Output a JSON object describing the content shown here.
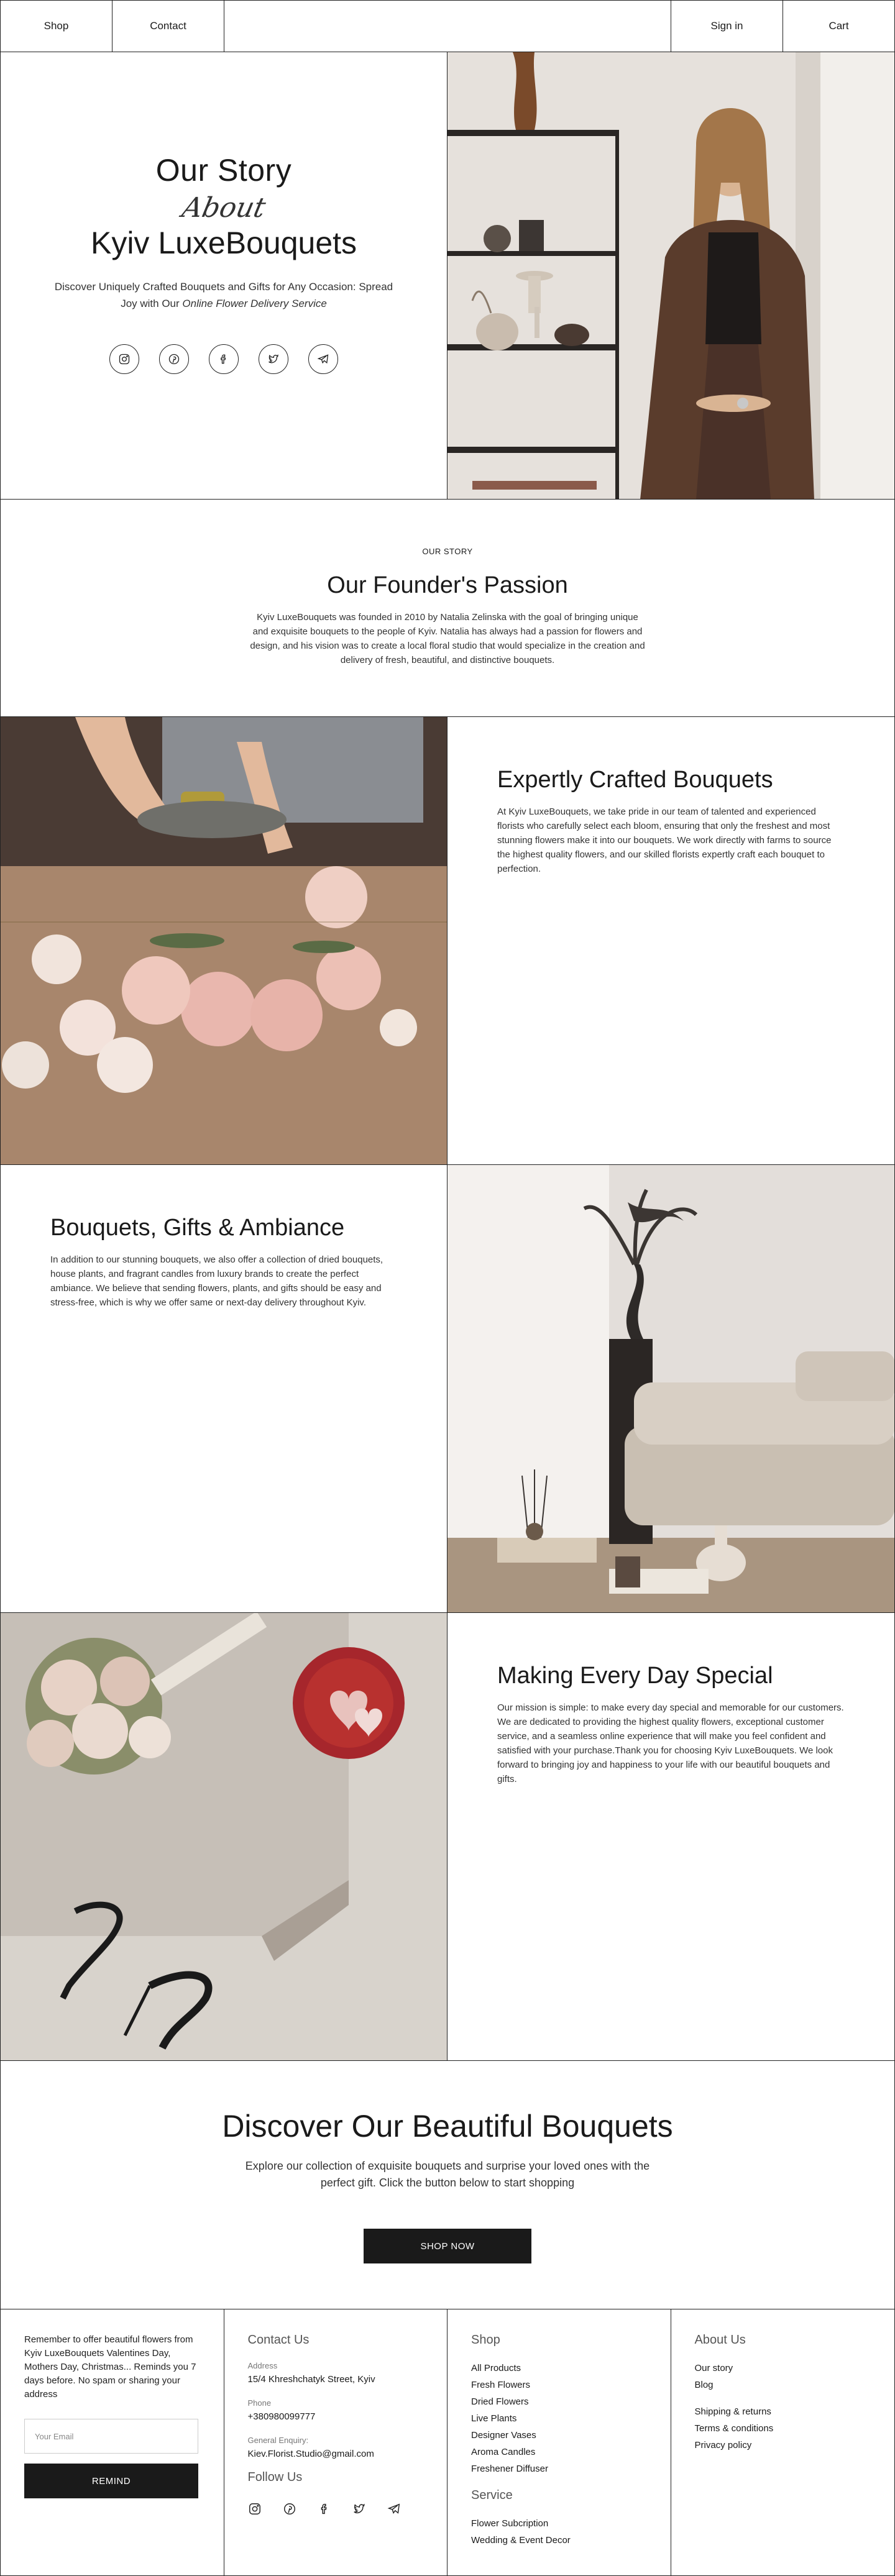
{
  "header": {
    "left": [
      "Shop",
      "Contact"
    ],
    "right": [
      "Sign in",
      "Cart"
    ]
  },
  "hero": {
    "title": "Our Story",
    "script": "About",
    "brand": "Kyiv LuxeBouquets",
    "desc_plain": "Discover Uniquely Crafted Bouquets and Gifts for Any Occasion: Spread Joy with Our ",
    "desc_em": "Online Flower Delivery Service"
  },
  "founder": {
    "eyebrow": "OUR STORY",
    "title": "Our Founder's Passion",
    "text": "Kyiv LuxeBouquets was founded in 2010 by Natalia Zelinska  with the goal of bringing unique and exquisite bouquets to the people of Kyiv. Natalia has always had a passion for flowers and design, and his vision was to create a local floral studio that would specialize in the creation and delivery of fresh, beautiful, and distinctive bouquets."
  },
  "crafted": {
    "title": "Expertly Crafted Bouquets",
    "text": "At Kyiv LuxeBouquets, we take pride in our team of talented and experienced florists who carefully select each bloom, ensuring that only the freshest and most stunning flowers make it into our bouquets. We work directly with farms to source the highest quality flowers, and our skilled florists expertly craft each bouquet to perfection."
  },
  "gifts": {
    "title": "Bouquets, Gifts & Ambiance",
    "text": "In addition to our stunning bouquets, we also offer a collection of dried bouquets, house plants, and fragrant candles from luxury brands to create the perfect ambiance. We believe that sending flowers, plants, and gifts should be easy and stress-free, which is why we offer same or next-day delivery throughout Kyiv."
  },
  "special": {
    "title": "Making Every Day Special",
    "text": "Our mission is simple: to make every day special and memorable for our customers. We are dedicated to providing the highest quality flowers, exceptional customer service, and a seamless online experience that will make you feel confident and satisfied with your purchase.Thank you for choosing Kyiv LuxeBouquets. We look forward to bringing joy and happiness to your life with our beautiful bouquets and gifts."
  },
  "cta": {
    "title": "Discover Our Beautiful Bouquets",
    "text": "Explore our collection of exquisite bouquets and surprise your loved ones with the perfect gift. Click the button below to start shopping",
    "button": "SHOP NOW"
  },
  "footer": {
    "remind_text": "Remember to offer beautiful flowers from Kyiv LuxeBouquets Valentines Day, Mothers Day, Christmas... Reminds you 7 days before. No spam or sharing your address",
    "email_placeholder": "Your Email",
    "remind_button": "REMIND",
    "contact": {
      "heading": "Contact Us",
      "address_label": "Address",
      "address": "15/4 Khreshchatyk Street, Kyiv",
      "phone_label": "Phone",
      "phone": "+380980099777",
      "email_label": "General Enquiry:",
      "email": "Kiev.Florist.Studio@gmail.com",
      "follow": "Follow Us"
    },
    "shop": {
      "heading": "Shop",
      "items": [
        "All Products",
        "Fresh Flowers",
        "Dried Flowers",
        "Live Plants",
        "Designer Vases",
        "Aroma Candles",
        "Freshener Diffuser"
      ],
      "service_heading": "Service",
      "service_items": [
        "Flower Subcription",
        "Wedding & Event Decor"
      ]
    },
    "about": {
      "heading": "About Us",
      "items": [
        "Our story",
        "Blog"
      ],
      "items2": [
        "Shipping & returns",
        "Terms & conditions",
        "Privacy policy"
      ]
    }
  }
}
